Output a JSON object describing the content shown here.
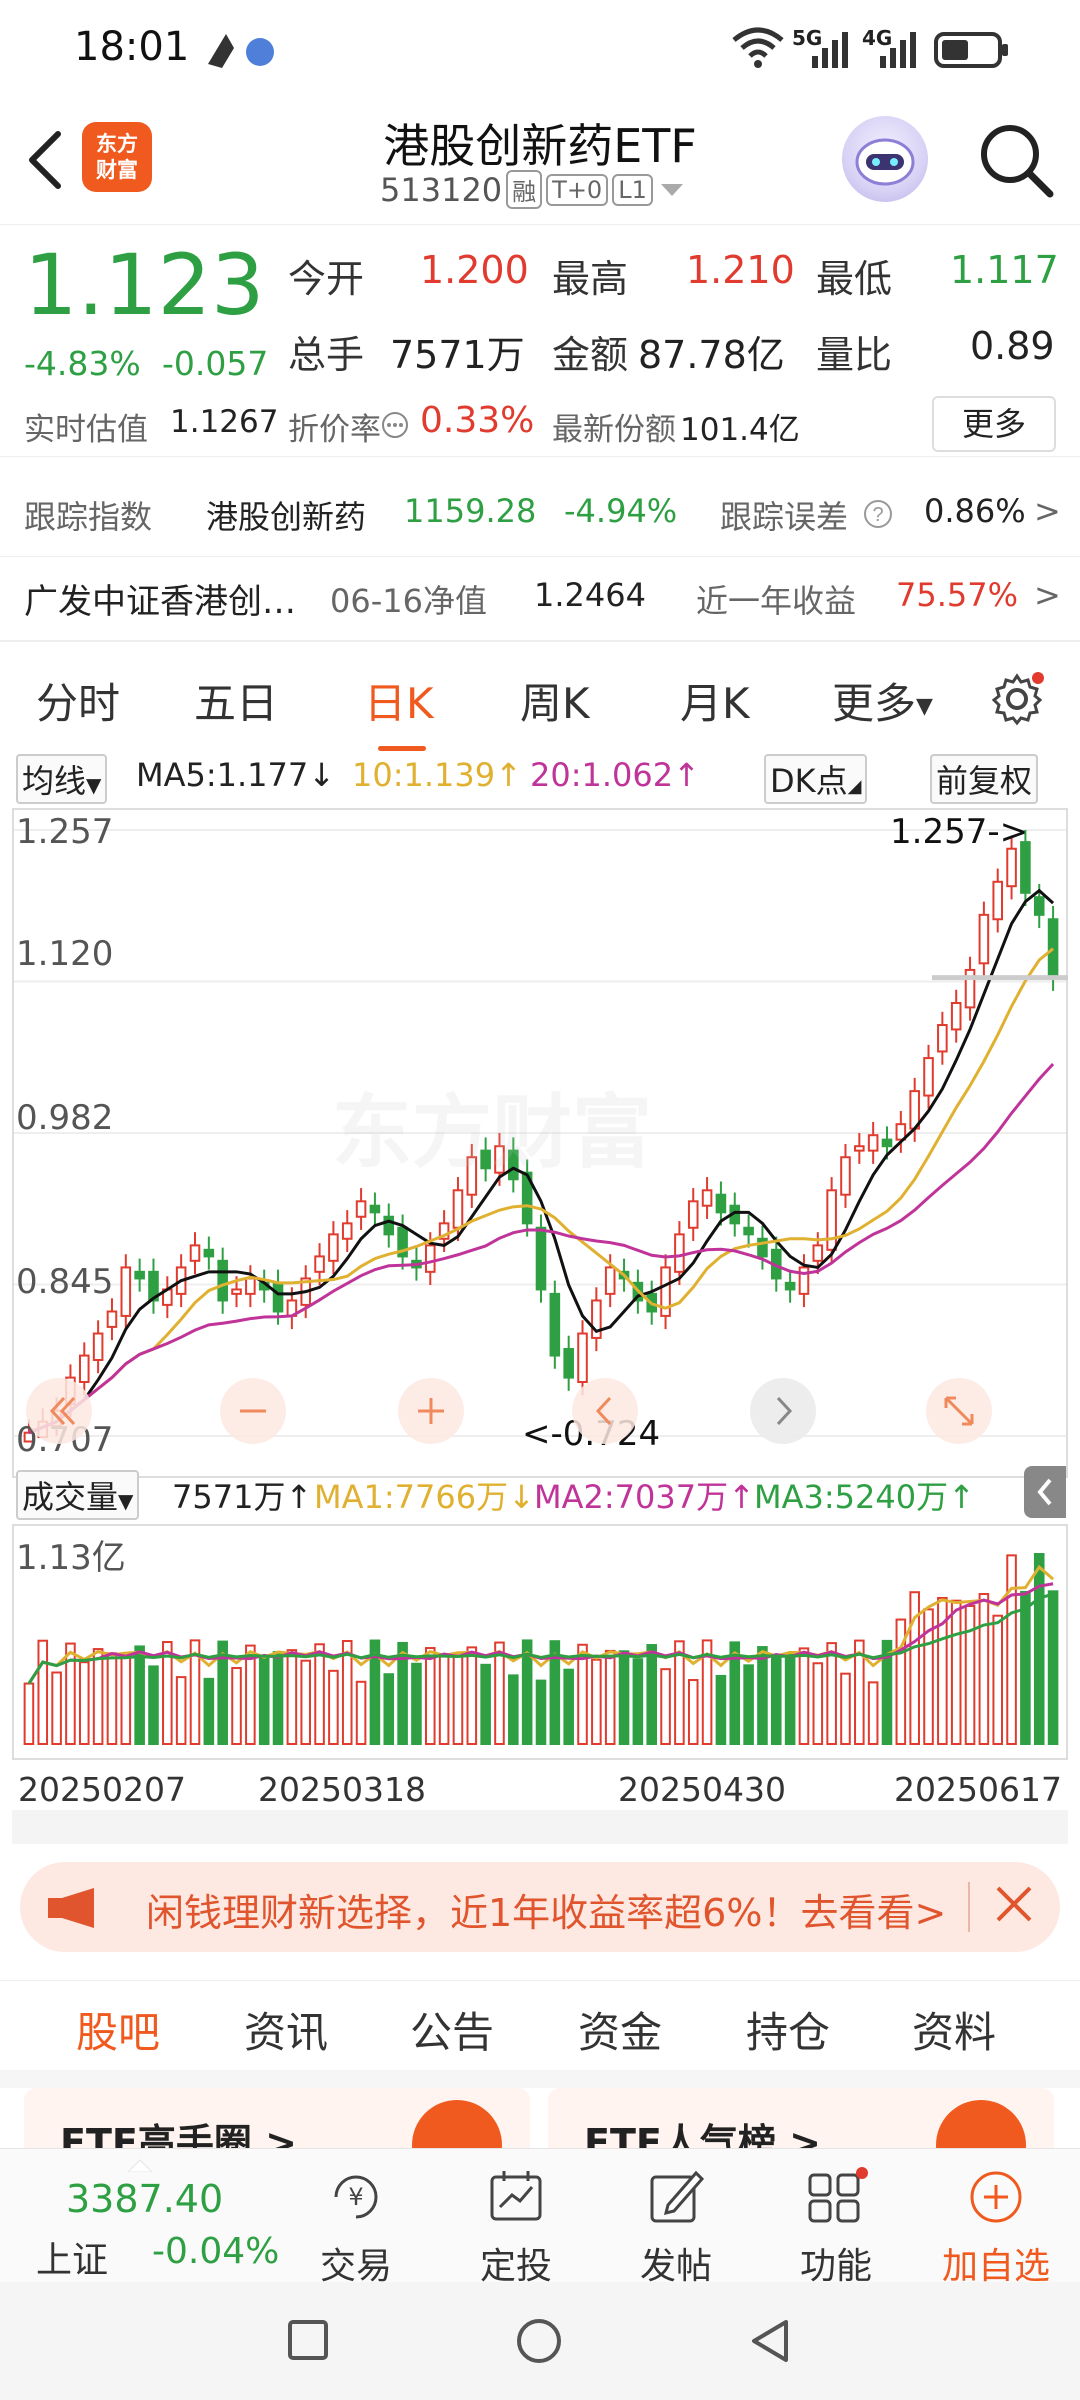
{
  "status": {
    "time": "18:01",
    "net1": "5G",
    "net2": "4G"
  },
  "header": {
    "logo": [
      "东方",
      "财富"
    ],
    "title": "港股创新药ETF",
    "code": "513120",
    "tags": [
      "融",
      "T+0",
      "L1"
    ]
  },
  "quote": {
    "price": "1.123",
    "pct": "-4.83%",
    "chg": "-0.057",
    "open_lbl": "今开",
    "open": "1.200",
    "high_lbl": "最高",
    "high": "1.210",
    "low_lbl": "最低",
    "low": "1.117",
    "vol_lbl": "总手",
    "vol": "7571万",
    "amt_lbl": "金额",
    "amt": "87.78亿",
    "ratio_lbl": "量比",
    "ratio": "0.89",
    "iopv_lbl": "实时估值",
    "iopv": "1.1267",
    "disc_lbl": "折价率",
    "disc": "0.33%",
    "shares_lbl": "最新份额",
    "shares": "101.4亿",
    "more": "更多"
  },
  "tracking": {
    "lbl": "跟踪指数",
    "index": "港股创新药",
    "value": "1159.28",
    "pct": "-4.94%",
    "err_lbl": "跟踪误差",
    "err": "0.86%",
    "arrow": ">"
  },
  "fund": {
    "name": "广发中证香港创…",
    "nav_lbl": "06-16净值",
    "nav": "1.2464",
    "ret_lbl": "近一年收益",
    "ret": "75.57%",
    "arrow": ">"
  },
  "ktabs": [
    "分时",
    "五日",
    "日K",
    "周K",
    "月K",
    "更多"
  ],
  "indicator": {
    "type": "均线",
    "ma5": "MA5:1.177",
    "ma10": "10:1.139",
    "ma20": "20:1.062",
    "dk": "DK点",
    "adj": "前复权"
  },
  "chart_labels": {
    "y": [
      "1.257",
      "1.120",
      "0.982",
      "0.845",
      "0.707"
    ],
    "hi_note": "1.257->",
    "lo_note": "<-0.724",
    "watermark": "东方财富"
  },
  "volume": {
    "type": "成交量",
    "cur": "7571万",
    "ma1": "MA1:7766万",
    "ma2": "MA2:7037万",
    "ma3": "MA3:5240万",
    "max": "1.13亿",
    "dates": [
      "20250207",
      "20250318",
      "20250430",
      "20250617"
    ]
  },
  "banner": {
    "text": "闲钱理财新选择，近1年收益率超6%！去看看>"
  },
  "btabs": [
    "股吧",
    "资讯",
    "公告",
    "资金",
    "持仓",
    "资料"
  ],
  "cards": [
    "ETF高手圈 >",
    "ETF人气榜 >"
  ],
  "bnav": {
    "index_value": "3387.40",
    "index_name": "上证",
    "index_pct": "-0.04%",
    "items": [
      "交易",
      "定投",
      "发帖",
      "功能",
      "加自选"
    ]
  },
  "colors": {
    "up": "#e03b2e",
    "down": "#2ea043",
    "accent": "#f05a1e"
  },
  "chart_data": {
    "type": "candlestick",
    "ylim": [
      0.707,
      1.257
    ],
    "x_start": "20250207",
    "x_end": "20250617",
    "high_mark": 1.257,
    "low_mark": 0.724,
    "close": [
      0.71,
      0.72,
      0.73,
      0.76,
      0.78,
      0.8,
      0.82,
      0.86,
      0.85,
      0.83,
      0.84,
      0.86,
      0.88,
      0.87,
      0.83,
      0.84,
      0.85,
      0.84,
      0.82,
      0.83,
      0.85,
      0.87,
      0.89,
      0.9,
      0.92,
      0.91,
      0.89,
      0.87,
      0.86,
      0.88,
      0.9,
      0.93,
      0.96,
      0.95,
      0.97,
      0.94,
      0.9,
      0.84,
      0.78,
      0.76,
      0.8,
      0.83,
      0.86,
      0.85,
      0.83,
      0.82,
      0.86,
      0.89,
      0.92,
      0.93,
      0.91,
      0.9,
      0.89,
      0.87,
      0.85,
      0.84,
      0.86,
      0.88,
      0.93,
      0.96,
      0.97,
      0.98,
      0.97,
      0.99,
      1.02,
      1.05,
      1.08,
      1.1,
      1.13,
      1.18,
      1.21,
      1.24,
      1.2,
      1.18,
      1.123
    ]
  }
}
